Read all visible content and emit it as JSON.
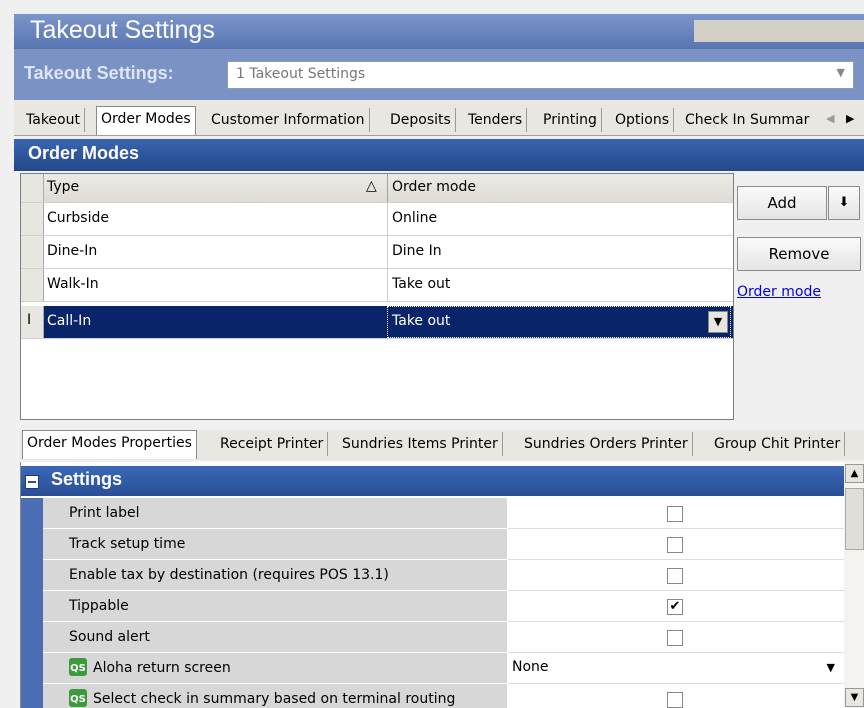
{
  "window": {
    "title": "Takeout Settings"
  },
  "settings_bar": {
    "label": "Takeout Settings:",
    "selected": "1 Takeout Settings"
  },
  "top_tabs": [
    "Takeout",
    "Order Modes",
    "Customer Information",
    "Deposits",
    "Tenders",
    "Printing",
    "Options",
    "Check In Summar"
  ],
  "section_title": "Order Modes",
  "grid": {
    "headers": {
      "type": "Type",
      "order_mode": "Order mode"
    },
    "rows": [
      {
        "type": "Curbside",
        "order_mode": "Online"
      },
      {
        "type": "Dine-In",
        "order_mode": "Dine In"
      },
      {
        "type": "Walk-In",
        "order_mode": "Take out"
      },
      {
        "type": "Call-In",
        "order_mode": "Take out"
      }
    ]
  },
  "buttons": {
    "add": "Add",
    "remove": "Remove",
    "link": "Order mode"
  },
  "bottom_tabs": [
    "Order Modes Properties",
    "Receipt Printer",
    "Sundries Items Printer",
    "Sundries Orders Printer",
    "Group Chit Printer"
  ],
  "props": {
    "group": "Settings",
    "items": [
      {
        "label": "Print label",
        "checked": false
      },
      {
        "label": "Track setup time",
        "checked": false
      },
      {
        "label": "Enable tax by destination (requires POS 13.1)",
        "checked": false
      },
      {
        "label": "Tippable",
        "checked": true
      },
      {
        "label": "Sound alert",
        "checked": false
      }
    ],
    "aloha_label": "Aloha return screen",
    "aloha_value": "None",
    "select_label": "Select check in summary based on terminal routing"
  },
  "colors": {
    "title": "#5a76b4",
    "section": "#2a4f96",
    "selection": "#0a246a"
  }
}
